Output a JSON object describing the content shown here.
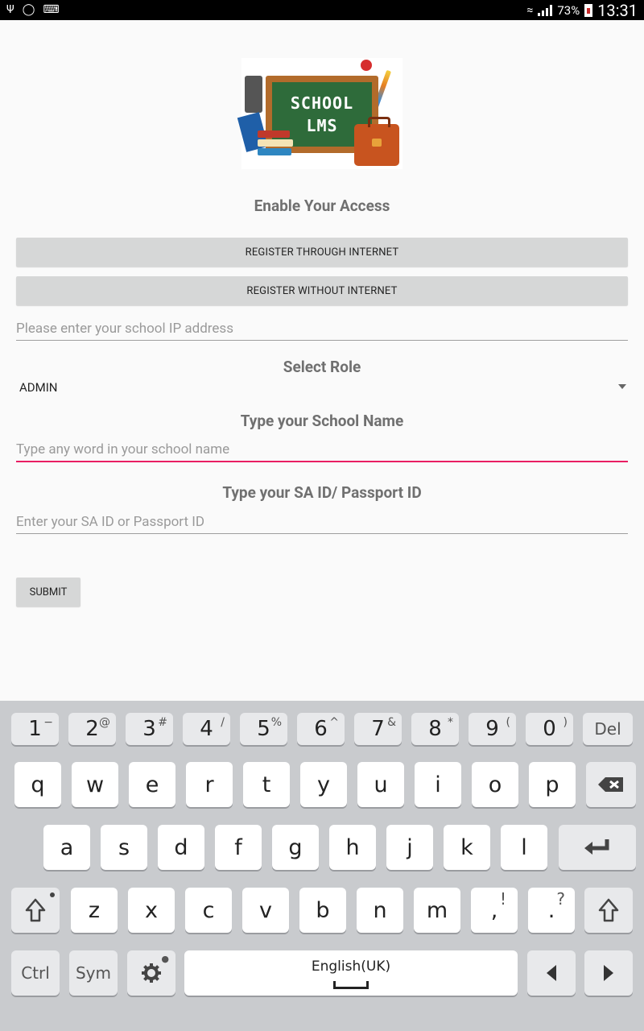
{
  "status_bar": {
    "battery": "73%",
    "time": "13:31"
  },
  "logo": {
    "line1": "SCHOOL",
    "line2": "LMS"
  },
  "page": {
    "heading": "Enable Your Access",
    "register_internet_label": "REGISTER THROUGH INTERNET",
    "register_offline_label": "REGISTER WITHOUT INTERNET",
    "ip_placeholder": "Please enter your school IP address",
    "select_role_label": "Select Role",
    "role_value": "ADMIN",
    "school_name_label": "Type your School Name",
    "school_name_placeholder": "Type any word in your school name",
    "id_label": "Type your SA ID/ Passport ID",
    "id_placeholder": "Enter your SA ID or Passport ID",
    "submit_label": "SUBMIT"
  },
  "keyboard": {
    "row_numbers": [
      {
        "main": "1",
        "sup": "−"
      },
      {
        "main": "2",
        "sup": "@"
      },
      {
        "main": "3",
        "sup": "#"
      },
      {
        "main": "4",
        "sup": "/"
      },
      {
        "main": "5",
        "sup": "%"
      },
      {
        "main": "6",
        "sup": "^"
      },
      {
        "main": "7",
        "sup": "&"
      },
      {
        "main": "8",
        "sup": "*"
      },
      {
        "main": "9",
        "sup": "("
      },
      {
        "main": "0",
        "sup": ")"
      }
    ],
    "del_label": "Del",
    "row1": [
      "q",
      "w",
      "e",
      "r",
      "t",
      "y",
      "u",
      "i",
      "o",
      "p"
    ],
    "row2": [
      "a",
      "s",
      "d",
      "f",
      "g",
      "h",
      "j",
      "k",
      "l"
    ],
    "row3": [
      "z",
      "x",
      "c",
      "v",
      "b",
      "n",
      "m"
    ],
    "comma": {
      "main": ",",
      "sup": "!"
    },
    "period": {
      "main": ".",
      "sup": "?"
    },
    "ctrl_label": "Ctrl",
    "sym_label": "Sym",
    "space_label": "English(UK)"
  }
}
